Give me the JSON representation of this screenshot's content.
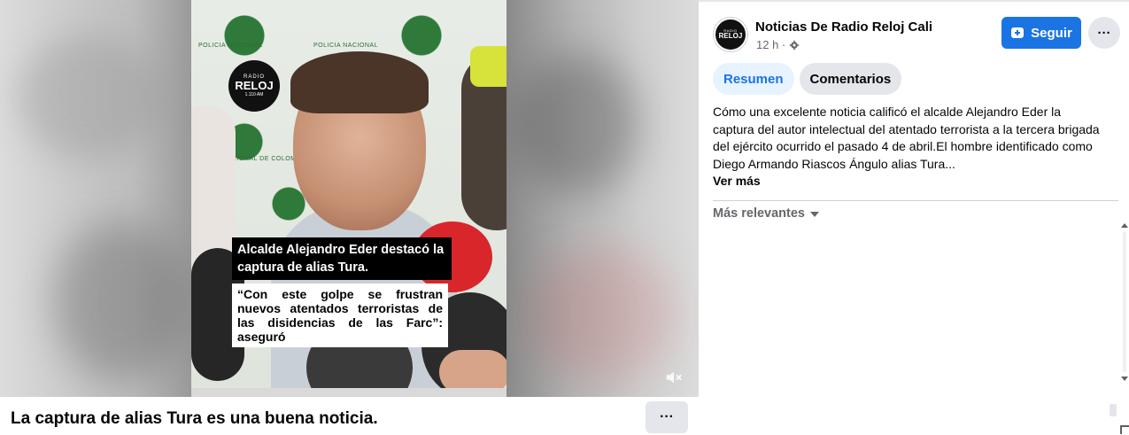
{
  "video": {
    "station_logo_lines": [
      "RADIO",
      "RELOJ",
      "1.110 AM"
    ],
    "caption_headline": "Alcalde Alejandro Eder destacó la captura de alias Tura.",
    "caption_quote": "“Con este golpe se frustran nuevos atentados terroristas de las disidencias de las Farc”: aseguró",
    "background_text_1": "POLICIA NACIONAL",
    "background_text_2": "POLICIA NACIONAL DE COLOMBIA",
    "muted_icon": "speaker-muted-icon"
  },
  "post": {
    "title": "La captura de alias Tura es una buena noticia.",
    "more_label": "···"
  },
  "sidebar": {
    "page_name": "Noticias De Radio Reloj Cali",
    "avatar_lines": [
      "RADIO",
      "RELOJ"
    ],
    "time_ago": "12 h ·",
    "follow_label": "Seguir",
    "more_label": "···",
    "tabs": [
      {
        "label": "Resumen",
        "active": true
      },
      {
        "label": "Comentarios",
        "active": false
      }
    ],
    "description": "Cómo una excelente noticia calificó el alcalde Alejandro Eder la captura del autor intelectual del atentado terrorista a la tercera brigada del ejército ocurrido el pasado 4 de abril.El hombre identificado como Diego Armando Riascos Ángulo alias Tura...",
    "see_more": "Ver más",
    "sort_label": "Más relevantes"
  },
  "colors": {
    "accent": "#1b74e4",
    "tab_active_bg": "#e7f3ff",
    "button_gray": "#e4e6eb",
    "secondary_text": "#65676b"
  }
}
